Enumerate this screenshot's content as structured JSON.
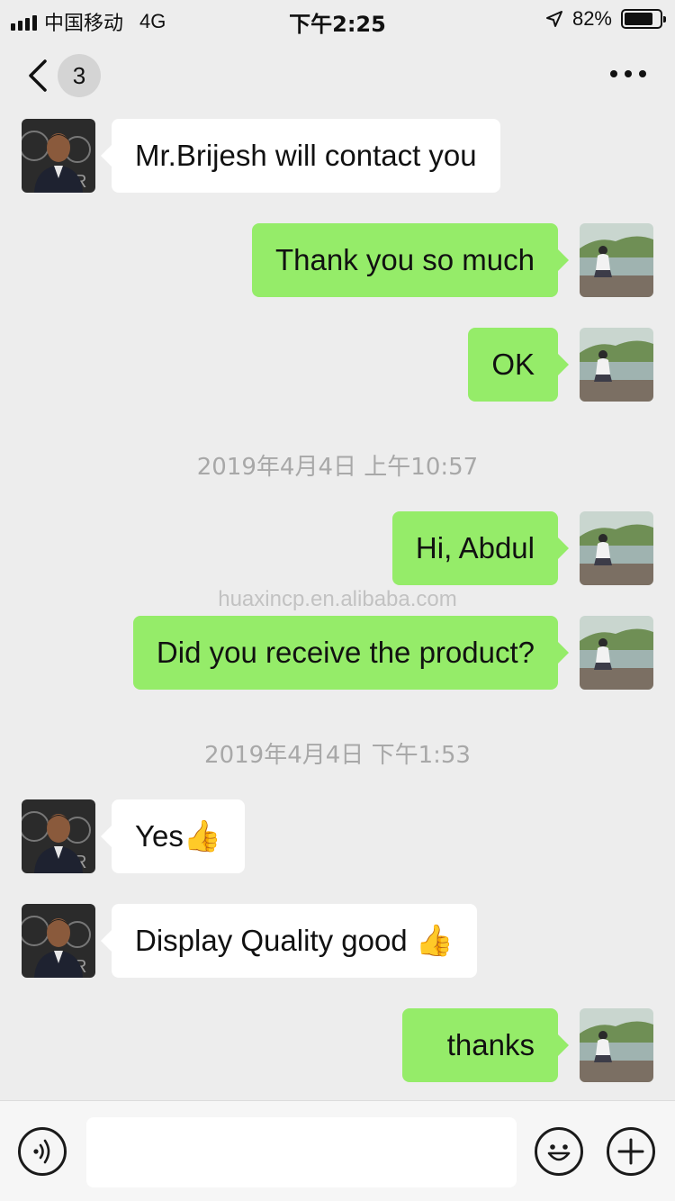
{
  "status_bar": {
    "carrier": "中国移动",
    "network": "4G",
    "time": "下午2:25",
    "battery": "82%",
    "battery_level": 0.82
  },
  "nav": {
    "unread_count": "3",
    "back_icon": "chevron-left-icon",
    "more_icon": "more-horizontal-icon"
  },
  "messages": [
    {
      "side": "in",
      "text": "Mr.Brijesh will contact you"
    },
    {
      "side": "out",
      "text": "Thank you so much"
    },
    {
      "side": "out",
      "text": "OK"
    },
    {
      "type": "time",
      "text": "2019年4月4日 上午10:57"
    },
    {
      "side": "out",
      "text": "Hi, Abdul"
    },
    {
      "side": "out",
      "text": "Did you receive the product?"
    },
    {
      "type": "time",
      "text": "2019年4月4日 下午1:53"
    },
    {
      "side": "in",
      "text": "Yes",
      "emoji": "👍"
    },
    {
      "side": "in",
      "text": "Display Quality good ",
      "emoji": "👍"
    },
    {
      "side": "out",
      "text": "thanks"
    }
  ],
  "watermark": "huaxincp.en.alibaba.com",
  "input_bar": {
    "voice_icon": "voice-icon",
    "emoji_icon": "emoji-icon",
    "plus_icon": "plus-icon",
    "input_value": ""
  },
  "colors": {
    "outgoing_bubble": "#95ec69",
    "incoming_bubble": "#ffffff",
    "background": "#ededed"
  }
}
